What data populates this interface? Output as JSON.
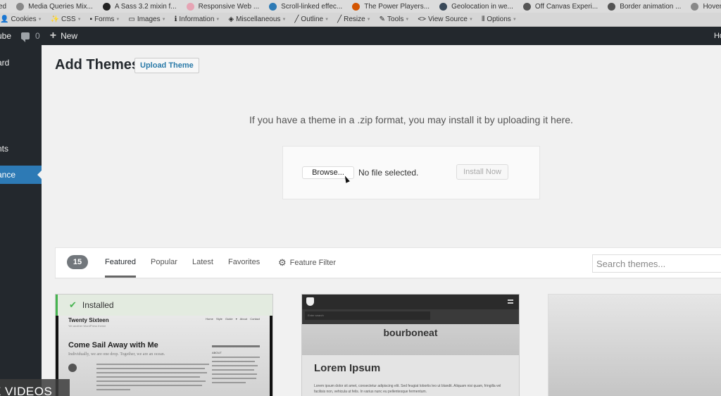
{
  "browser": {
    "bookmarks": [
      {
        "label": "ed",
        "icon": "folder-icon",
        "color": "#dcdcdc"
      },
      {
        "label": "Media Queries Mix...",
        "icon": "globe-icon",
        "color": "#888888"
      },
      {
        "label": "A Sass 3.2 mixin f...",
        "icon": "github-icon",
        "color": "#222222"
      },
      {
        "label": "Responsive Web ...",
        "icon": "star-icon",
        "color": "#e6a4b4"
      },
      {
        "label": "Scroll-linked effec...",
        "icon": "chat-icon",
        "color": "#2d7ab5"
      },
      {
        "label": "The Power Players...",
        "icon": "icu-icon",
        "color": "#d35400"
      },
      {
        "label": "Geolocation in we...",
        "icon": "photo-icon",
        "color": "#3a4a5a"
      },
      {
        "label": "Off Canvas Experi...",
        "icon": "codepen-icon",
        "color": "#555555"
      },
      {
        "label": "Border animation ...",
        "icon": "codepen-icon",
        "color": "#555555"
      },
      {
        "label": "Hover...",
        "icon": "globe-icon",
        "color": "#888888"
      }
    ],
    "devtoolbar": [
      {
        "label": "Cookies",
        "glyph": "👤",
        "icon": "cookies-icon"
      },
      {
        "label": "CSS",
        "glyph": "✨",
        "icon": "css-wand-icon"
      },
      {
        "label": "Forms",
        "glyph": "▪",
        "icon": "forms-icon"
      },
      {
        "label": "Images",
        "glyph": "▭",
        "icon": "images-icon"
      },
      {
        "label": "Information",
        "glyph": "ℹ",
        "icon": "information-icon"
      },
      {
        "label": "Miscellaneous",
        "glyph": "◈",
        "icon": "miscellaneous-icon"
      },
      {
        "label": "Outline",
        "glyph": "╱",
        "icon": "outline-icon"
      },
      {
        "label": "Resize",
        "glyph": "╱",
        "icon": "resize-icon"
      },
      {
        "label": "Tools",
        "glyph": "✎",
        "icon": "tools-icon"
      },
      {
        "label": "View Source",
        "glyph": "<>",
        "icon": "view-source-icon"
      },
      {
        "label": "Options",
        "glyph": "⦀",
        "icon": "options-icon"
      }
    ]
  },
  "adminbar": {
    "site": "ube",
    "comments_count": "0",
    "new_label": "New",
    "howdy": "Ho"
  },
  "sidebar": {
    "items": [
      {
        "label": "ard",
        "active": false
      },
      {
        "label": "nts",
        "active": false
      },
      {
        "label": "ance",
        "active": true
      }
    ]
  },
  "main": {
    "title": "Add Themes",
    "upload_button": "Upload Theme",
    "upload_description": "If you have a theme in a .zip format, you may install it by uploading it here.",
    "browse_button": "Browse...",
    "file_status": "No file selected.",
    "install_button": "Install Now"
  },
  "filter": {
    "count": "15",
    "tabs": [
      {
        "label": "Featured",
        "active": true
      },
      {
        "label": "Popular",
        "active": false
      },
      {
        "label": "Latest",
        "active": false
      },
      {
        "label": "Favorites",
        "active": false
      }
    ],
    "feature_filter": "Feature Filter",
    "search_placeholder": "Search themes..."
  },
  "themes": [
    {
      "installed_label": "Installed",
      "preview": {
        "site_title": "Twenty Sixteen",
        "tagline": "Yet another WordPress theme",
        "nav": "Home  Style Guide ▾  About  Contact",
        "post_title": "Come Sail Away with Me",
        "post_subtitle": "Individually, we are one drop. Together, we are an ocean.",
        "sidebar_label": "ABOUT"
      }
    },
    {
      "preview": {
        "search_placeholder": "Enter search",
        "site_title": "bourboneat",
        "heading": "Lorem Ipsum",
        "body": "Lorem ipsum dolor sit amet, consectetur adipiscing elit. Sed feugiat lobortis leo ut blandit. Aliquam nisi quam, fringilla vel facilisis non, vehicula ut felis. In varius nunc eu pellentesque fermentum."
      }
    },
    {
      "preview": {}
    }
  ],
  "video_overlay": "E VIDEOS"
}
